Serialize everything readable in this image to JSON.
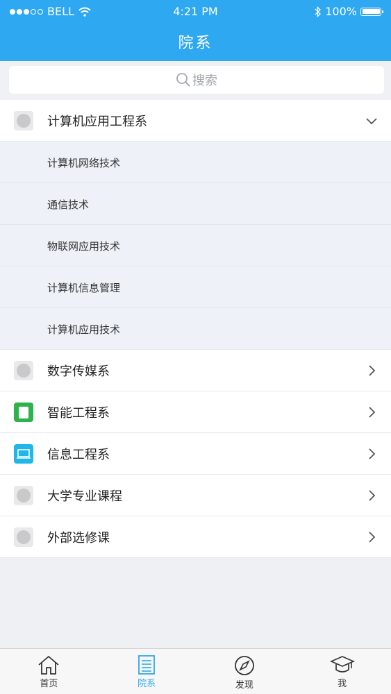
{
  "status": {
    "carrier": "BELL",
    "time": "4:21 PM",
    "battery": "100%"
  },
  "nav": {
    "title": "院系"
  },
  "search": {
    "placeholder": "搜索"
  },
  "departments": [
    {
      "label": "计算机应用工程系",
      "expanded": true,
      "icon": "department-placeholder-icon",
      "children": [
        "计算机网络技术",
        "通信技术",
        "物联网应用技术",
        "计算机信息管理",
        "计算机应用技术"
      ]
    },
    {
      "label": "数字传媒系",
      "icon": "department-placeholder-icon"
    },
    {
      "label": "智能工程系",
      "icon": "tablet-icon"
    },
    {
      "label": "信息工程系",
      "icon": "laptop-icon"
    },
    {
      "label": "大学专业课程",
      "icon": "department-placeholder-icon"
    },
    {
      "label": "外部选修课",
      "icon": "department-placeholder-icon"
    }
  ],
  "tabs": [
    {
      "label": "首页",
      "icon": "home-icon"
    },
    {
      "label": "院系",
      "icon": "list-icon",
      "active": true
    },
    {
      "label": "发现",
      "icon": "compass-icon"
    },
    {
      "label": "我",
      "icon": "graduation-cap-icon"
    }
  ],
  "colors": {
    "accent": "#2ea8f0",
    "green": "#2db34a",
    "cyan": "#1fb6e8"
  }
}
